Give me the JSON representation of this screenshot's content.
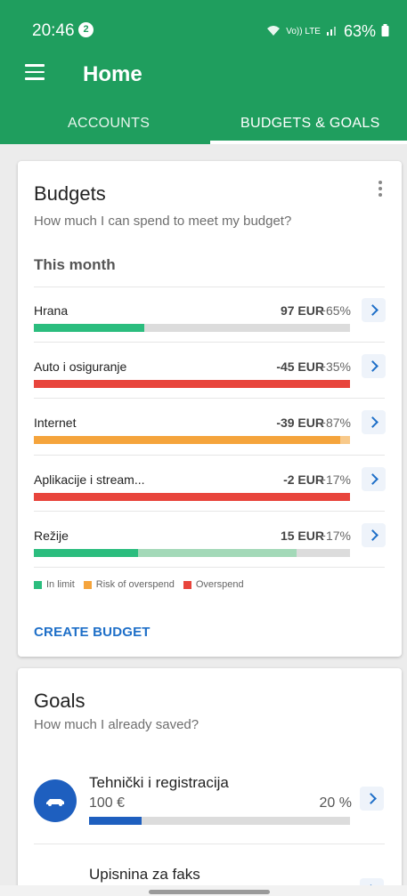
{
  "status": {
    "time": "20:46",
    "notification_count": "2",
    "network": "Vo)) LTE",
    "battery": "63%"
  },
  "appbar": {
    "title": "Home",
    "menu_icon": "hamburger-menu-icon"
  },
  "tabs": [
    {
      "label": "ACCOUNTS",
      "active": false
    },
    {
      "label": "BUDGETS & GOALS",
      "active": true
    }
  ],
  "budgets": {
    "title": "Budgets",
    "subtitle": "How much I can spend to meet my budget?",
    "period": "This month",
    "rows": [
      {
        "name": "Hrana",
        "amount": "97 EUR",
        "pct": "−65%",
        "segments": [
          {
            "color": "#2bbd7e",
            "fraction": 0.35
          }
        ]
      },
      {
        "name": "Auto i osiguranje",
        "amount": "-45 EUR",
        "pct": "+35%",
        "segments": [
          {
            "color": "#e8453c",
            "fraction": 1.0
          }
        ]
      },
      {
        "name": "Internet",
        "amount": "-39 EUR",
        "pct": "+87%",
        "segments": [
          {
            "color": "#f5a43c",
            "fraction": 0.97
          },
          {
            "color": "#f8c98a",
            "fraction": 0.03
          }
        ]
      },
      {
        "name": "Aplikacije i stream...",
        "amount": "-2 EUR",
        "pct": "+17%",
        "segments": [
          {
            "color": "#e8453c",
            "fraction": 1.0
          }
        ]
      },
      {
        "name": "Režije",
        "amount": "15 EUR",
        "pct": "−17%",
        "segments": [
          {
            "color": "#2bbd7e",
            "fraction": 0.33
          },
          {
            "color": "#a3d9b8",
            "fraction": 0.5
          }
        ]
      }
    ],
    "legend": [
      {
        "label": "In limit",
        "color": "#2bbd7e"
      },
      {
        "label": "Risk of overspend",
        "color": "#f5a43c"
      },
      {
        "label": "Overspend",
        "color": "#e8453c"
      }
    ],
    "create_label": "CREATE BUDGET"
  },
  "goals": {
    "title": "Goals",
    "subtitle": "How much I already saved?",
    "items": [
      {
        "name": "Tehnički i registracija",
        "amount": "100 €",
        "pct": "20 %",
        "progress": 0.2,
        "icon": "car-icon",
        "icon_color": "#1e5fbf"
      },
      {
        "name": "Upisnina za faks",
        "amount": "",
        "pct": "",
        "progress": 0,
        "icon": "graduation-cap-icon",
        "icon_color": "#b04fc8"
      }
    ]
  }
}
